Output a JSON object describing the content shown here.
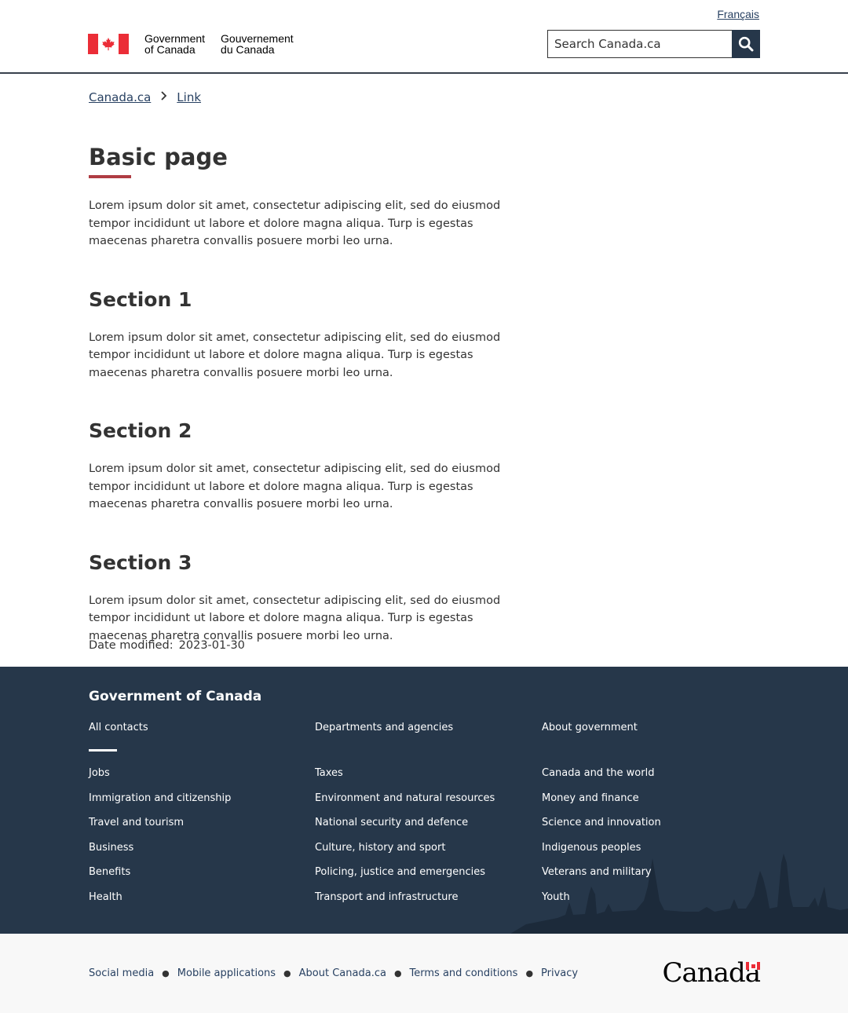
{
  "header": {
    "lang_toggle": "Français",
    "signature_en": [
      "Government",
      "of Canada"
    ],
    "signature_fr": [
      "Gouvernement",
      "du Canada"
    ],
    "search_placeholder": "Search Canada.ca",
    "search_icon": "search-icon",
    "flag_red": "#eb2d37"
  },
  "breadcrumb": [
    "Canada.ca",
    "Link"
  ],
  "main": {
    "title": "Basic page",
    "intro": "Lorem ipsum dolor sit amet, consectetur adipiscing elit, sed do eiusmod tempor incididunt ut labore et dolore magna aliqua. Turp is egestas maecenas pharetra convallis posuere morbi leo urna.",
    "sections": [
      {
        "heading": "Section 1",
        "text": "Lorem ipsum dolor sit amet, consectetur adipiscing elit, sed do eiusmod tempor incididunt ut labore et dolore magna aliqua. Turp is egestas maecenas pharetra convallis posuere morbi leo urna."
      },
      {
        "heading": "Section 2",
        "text": "Lorem ipsum dolor sit amet, consectetur adipiscing elit, sed do eiusmod tempor incididunt ut labore et dolore magna aliqua. Turp is egestas maecenas pharetra convallis posuere morbi leo urna."
      },
      {
        "heading": "Section 3",
        "text": "Lorem ipsum dolor sit amet, consectetur adipiscing elit, sed do eiusmod tempor incididunt ut labore et dolore magna aliqua. Turp is egestas maecenas pharetra convallis posuere morbi leo urna."
      }
    ],
    "date_label": "Date modified:",
    "date_value": "2023-01-30",
    "accent_color": "#af3c43"
  },
  "footer": {
    "title": "Government of Canada",
    "bg_color": "#26374a",
    "columns": [
      {
        "top": "All contacts",
        "items": [
          "Jobs",
          "Immigration and citizenship",
          "Travel and tourism",
          "Business",
          "Benefits",
          "Health"
        ]
      },
      {
        "top": "Departments and agencies",
        "items": [
          "Taxes",
          "Environment and natural resources",
          "National security and defence",
          "Culture, history and sport",
          "Policing, justice and emergencies",
          "Transport and infrastructure"
        ]
      },
      {
        "top": "About government",
        "items": [
          "Canada and the world",
          "Money and finance",
          "Science and innovation",
          "Indigenous peoples",
          "Veterans and military",
          "Youth"
        ]
      }
    ],
    "sub_links": [
      "Social media",
      "Mobile applications",
      "About Canada.ca",
      "Terms and conditions",
      "Privacy"
    ],
    "wordmark": "Canada"
  }
}
